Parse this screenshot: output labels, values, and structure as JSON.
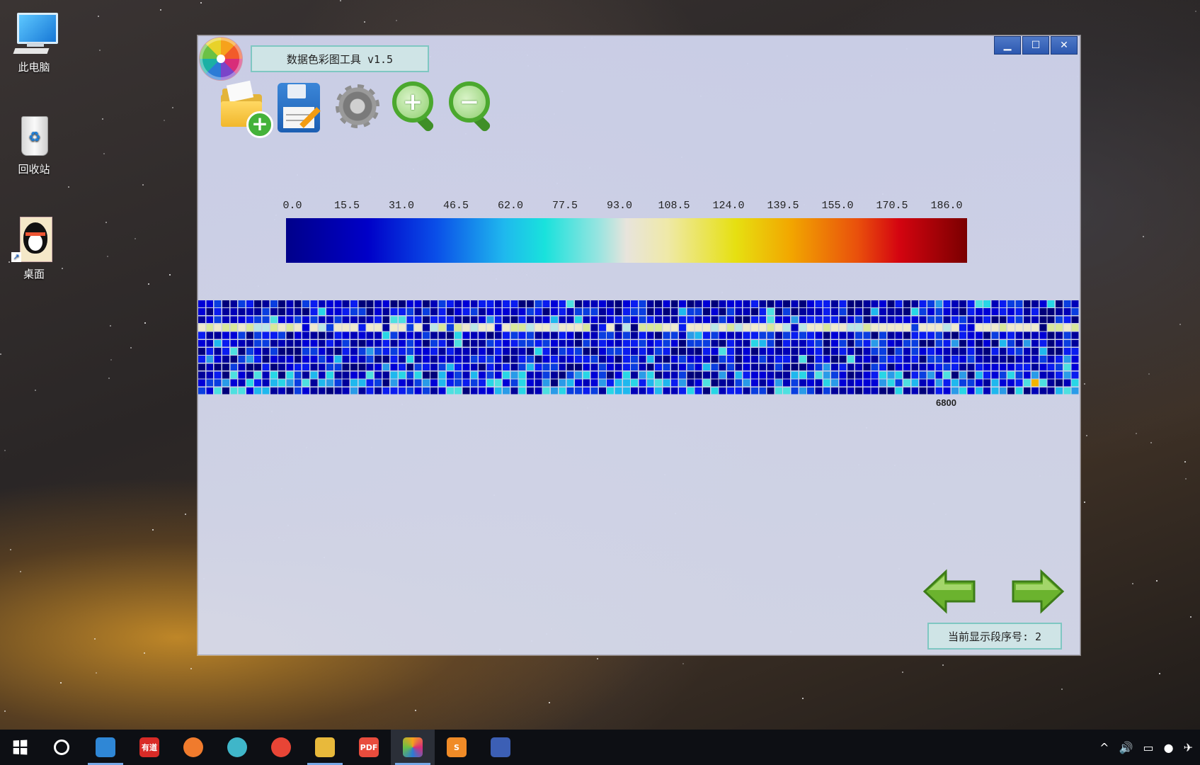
{
  "desktop": {
    "icons": [
      {
        "label": "此电脑"
      },
      {
        "label": "回收站"
      },
      {
        "label": "桌面"
      }
    ]
  },
  "window": {
    "title": "数据色彩图工具 v1.5",
    "controls": [
      "minimize",
      "maximize",
      "close"
    ],
    "toolbar": [
      {
        "name": "open-file",
        "icon": "folder-plus-icon"
      },
      {
        "name": "save",
        "icon": "floppy-disk-icon"
      },
      {
        "name": "settings",
        "icon": "gear-icon"
      },
      {
        "name": "zoom-in",
        "icon": "zoom-in-icon"
      },
      {
        "name": "zoom-out",
        "icon": "zoom-out-icon"
      }
    ],
    "colorbar": {
      "labels": [
        "0.0",
        "15.5",
        "31.0",
        "46.5",
        "62.0",
        "77.5",
        "93.0",
        "108.5",
        "124.0",
        "139.5",
        "155.0",
        "170.5",
        "186.0"
      ],
      "min": 0.0,
      "max": 186.0,
      "palette": [
        "#00008a",
        "#0000c8",
        "#0a4ee8",
        "#1fb8ee",
        "#19e2dc",
        "#e8e4dc",
        "#e6e011",
        "#f2a700",
        "#e94f0c",
        "#d40410",
        "#7a0000"
      ]
    },
    "heatmap": {
      "rows": 12,
      "cols": 110,
      "axis_label": "6800"
    },
    "status": "当前显示段序号: 2"
  },
  "taskbar": {
    "apps": [
      {
        "name": "contacts",
        "color": "#2f87d6",
        "active": false
      },
      {
        "name": "youdao",
        "color": "#d92b27",
        "text": "有道",
        "active": false
      },
      {
        "name": "music",
        "color": "#f07b2d",
        "active": false
      },
      {
        "name": "360",
        "color": "#3fb6c9",
        "active": false
      },
      {
        "name": "chrome",
        "color": "#e84536",
        "active": false
      },
      {
        "name": "explorer",
        "color": "#e8b93b",
        "active": false
      },
      {
        "name": "pdf",
        "color": "#e84c3d",
        "text": "PDF",
        "active": false
      },
      {
        "name": "color-tool",
        "color": "#ffffff",
        "active": true
      },
      {
        "name": "sublime",
        "color": "#f08b27",
        "text": "S",
        "active": false
      },
      {
        "name": "pen-app",
        "color": "#3c5fb5",
        "active": false
      }
    ]
  }
}
